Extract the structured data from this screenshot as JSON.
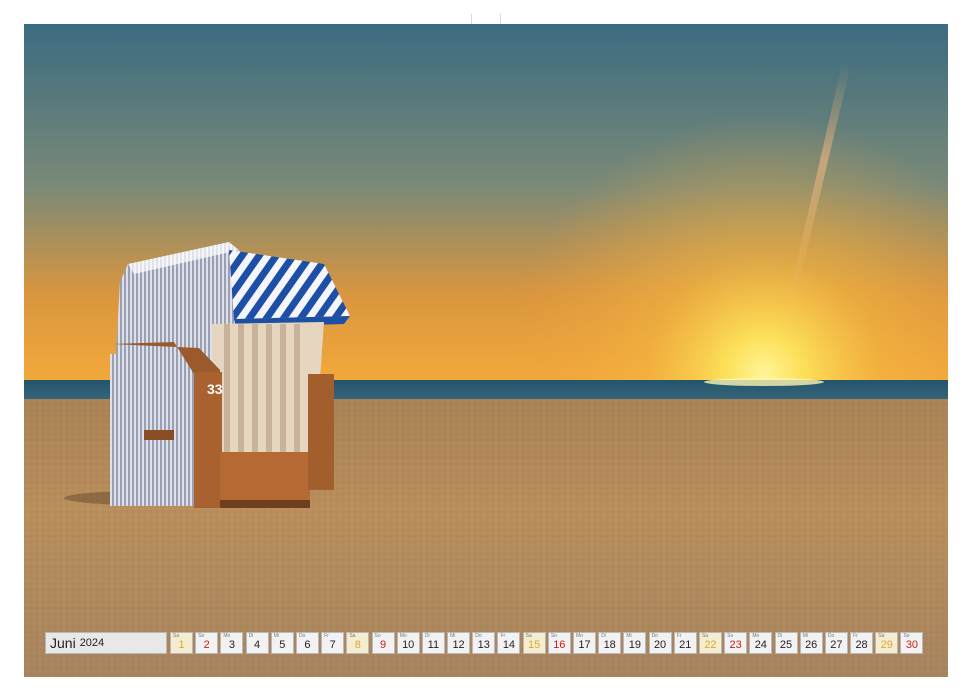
{
  "calendar": {
    "month": "Juni",
    "year": "2024",
    "days": [
      {
        "d": "1",
        "wd": "Sa",
        "type": "sat"
      },
      {
        "d": "2",
        "wd": "So",
        "type": "sun"
      },
      {
        "d": "3",
        "wd": "Mo",
        "type": "wd"
      },
      {
        "d": "4",
        "wd": "Di",
        "type": "wd"
      },
      {
        "d": "5",
        "wd": "Mi",
        "type": "wd"
      },
      {
        "d": "6",
        "wd": "Do",
        "type": "wd"
      },
      {
        "d": "7",
        "wd": "Fr",
        "type": "wd"
      },
      {
        "d": "8",
        "wd": "Sa",
        "type": "sat"
      },
      {
        "d": "9",
        "wd": "So",
        "type": "sun"
      },
      {
        "d": "10",
        "wd": "Mo",
        "type": "wd"
      },
      {
        "d": "11",
        "wd": "Di",
        "type": "wd"
      },
      {
        "d": "12",
        "wd": "Mi",
        "type": "wd"
      },
      {
        "d": "13",
        "wd": "Do",
        "type": "wd"
      },
      {
        "d": "14",
        "wd": "Fr",
        "type": "wd"
      },
      {
        "d": "15",
        "wd": "Sa",
        "type": "sat"
      },
      {
        "d": "16",
        "wd": "So",
        "type": "sun"
      },
      {
        "d": "17",
        "wd": "Mo",
        "type": "wd"
      },
      {
        "d": "18",
        "wd": "Di",
        "type": "wd"
      },
      {
        "d": "19",
        "wd": "Mi",
        "type": "wd"
      },
      {
        "d": "20",
        "wd": "Do",
        "type": "wd"
      },
      {
        "d": "21",
        "wd": "Fr",
        "type": "wd"
      },
      {
        "d": "22",
        "wd": "Sa",
        "type": "sat"
      },
      {
        "d": "23",
        "wd": "So",
        "type": "sun"
      },
      {
        "d": "24",
        "wd": "Mo",
        "type": "wd"
      },
      {
        "d": "25",
        "wd": "Di",
        "type": "wd"
      },
      {
        "d": "26",
        "wd": "Mi",
        "type": "wd"
      },
      {
        "d": "27",
        "wd": "Do",
        "type": "wd"
      },
      {
        "d": "28",
        "wd": "Fr",
        "type": "wd"
      },
      {
        "d": "29",
        "wd": "Sa",
        "type": "sat"
      },
      {
        "d": "30",
        "wd": "So",
        "type": "sun"
      }
    ]
  },
  "photo": {
    "chair_number": "33",
    "colors": {
      "sky_top": "#3d6f86",
      "sky_horizon": "#f2a43a",
      "sun": "#fff27a",
      "sea": "#2f5f78",
      "sand": "#b88c5a",
      "awning_blue": "#1d4fa8",
      "wicker": "#d9dbe4",
      "wood": "#9a5a2c"
    }
  }
}
